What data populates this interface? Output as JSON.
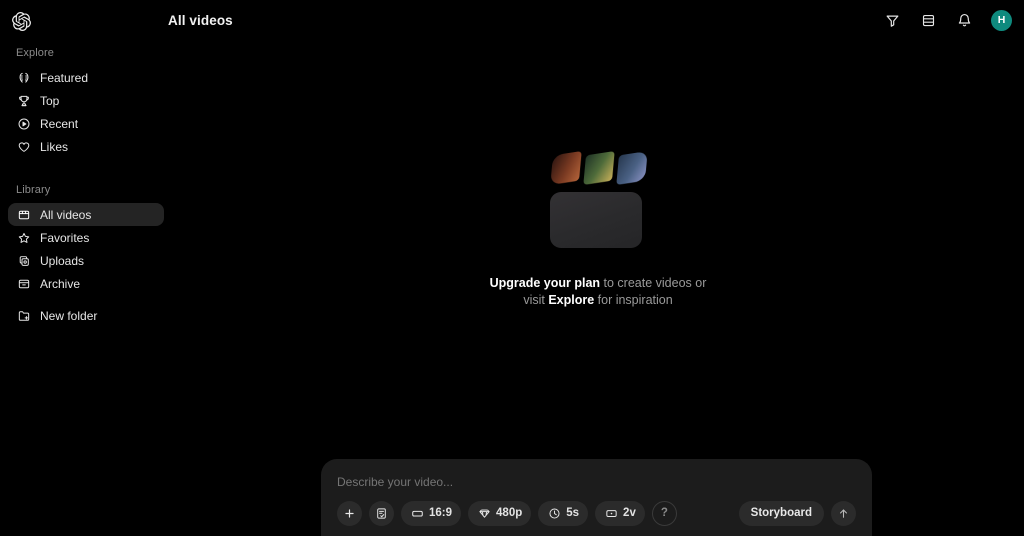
{
  "app": {
    "logo_icon": "openai-logo-icon",
    "title": "All videos",
    "background_color": "#000000"
  },
  "header": {
    "actions": [
      {
        "name": "filter",
        "icon": "filter-funnel-icon",
        "label": "Filter"
      },
      {
        "name": "view",
        "icon": "list-view-icon",
        "label": "View"
      },
      {
        "name": "notifications",
        "icon": "bell-icon",
        "label": "Notifications"
      }
    ],
    "avatar": {
      "initial": "H",
      "color": "#0f8a7e"
    }
  },
  "sidebar": {
    "sections": [
      {
        "label": "Explore",
        "items": [
          {
            "label": "Featured",
            "icon": "laurel-wreath-icon",
            "active": false
          },
          {
            "label": "Top",
            "icon": "trophy-icon",
            "active": false
          },
          {
            "label": "Recent",
            "icon": "play-circle-icon",
            "active": false
          },
          {
            "label": "Likes",
            "icon": "heart-icon",
            "active": false
          }
        ]
      },
      {
        "label": "Library",
        "items": [
          {
            "label": "All videos",
            "icon": "clapperboard-icon",
            "active": true
          },
          {
            "label": "Favorites",
            "icon": "star-icon",
            "active": false
          },
          {
            "label": "Uploads",
            "icon": "stacked-squares-icon",
            "active": false
          },
          {
            "label": "Archive",
            "icon": "archive-box-icon",
            "active": false
          }
        ],
        "extra": [
          {
            "label": "New folder",
            "icon": "folder-plus-icon",
            "active": false
          }
        ]
      }
    ]
  },
  "main": {
    "empty_state": {
      "illustration": "clapperboard-illustration",
      "line1_bold": "Upgrade your plan",
      "line1_rest": " to create videos or",
      "line2_pre": "visit ",
      "line2_bold": "Explore",
      "line2_post": " for inspiration"
    }
  },
  "composer": {
    "placeholder": "Describe your video...",
    "value": "",
    "chips": [
      {
        "name": "add",
        "icon": "plus-icon",
        "label": "",
        "round": true
      },
      {
        "name": "preset",
        "icon": "document-check-icon",
        "label": "",
        "round": true
      },
      {
        "name": "aspect-ratio",
        "icon": "aspect-ratio-icon",
        "label": "16:9",
        "round": false
      },
      {
        "name": "resolution",
        "icon": "gem-icon",
        "label": "480p",
        "round": false
      },
      {
        "name": "duration",
        "icon": "clock-icon",
        "label": "5s",
        "round": false
      },
      {
        "name": "variants",
        "icon": "variants-icon",
        "label": "2v",
        "round": false
      },
      {
        "name": "help",
        "icon": "question-mark-icon",
        "label": "?",
        "round": true,
        "ghost": true
      }
    ],
    "storyboard_label": "Storyboard",
    "send_icon": "arrow-up-icon"
  }
}
